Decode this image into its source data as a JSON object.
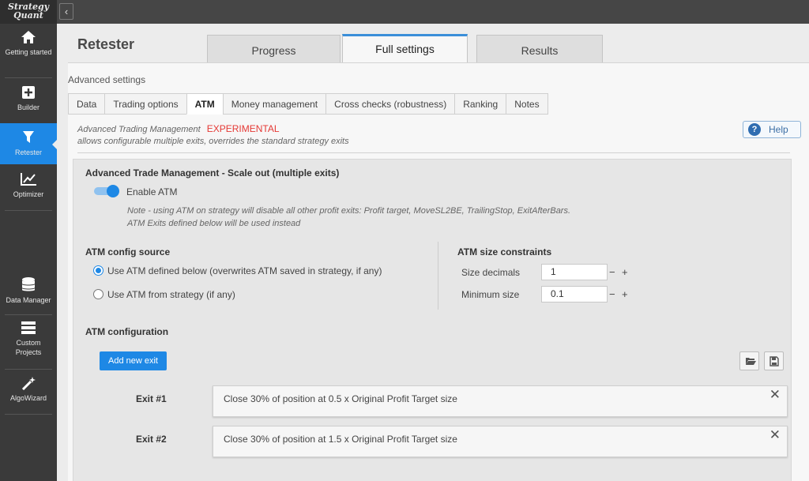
{
  "app": {
    "logo_line1": "Strategy",
    "logo_line2": "Quant"
  },
  "sidebar": {
    "items": [
      {
        "label": "Getting started",
        "icon": "home-icon"
      },
      {
        "label": "Builder",
        "icon": "plus-box-icon"
      },
      {
        "label": "Retester",
        "icon": "filter-icon",
        "active": true
      },
      {
        "label": "Optimizer",
        "icon": "chart-line-icon"
      },
      {
        "label": "Data Manager",
        "icon": "database-icon"
      },
      {
        "label": "Custom Projects",
        "icon": "projects-icon"
      },
      {
        "label": "AlgoWizard",
        "icon": "magic-wand-icon"
      }
    ]
  },
  "header": {
    "title": "Retester",
    "tabs": [
      {
        "label": "Progress"
      },
      {
        "label": "Full settings",
        "active": true
      },
      {
        "label": "Results"
      }
    ]
  },
  "settings": {
    "section_label": "Advanced settings",
    "tabs": [
      "Data",
      "Trading options",
      "ATM",
      "Money management",
      "Cross checks (robustness)",
      "Ranking",
      "Notes"
    ],
    "active_tab": "ATM"
  },
  "atm": {
    "info_title": "Advanced Trading Management",
    "experimental": "EXPERIMENTAL",
    "info_desc": "allows configurable multiple exits, overrides the standard strategy exits",
    "help_label": "Help",
    "box_title": "Advanced Trade Management - Scale out (multiple exits)",
    "enable_label": "Enable ATM",
    "enabled": true,
    "note_line1": "Note - using ATM on strategy will disable all other profit exits: Profit target, MoveSL2BE, TrailingStop, ExitAfterBars.",
    "note_line2": "ATM Exits defined below will be used instead",
    "config_source_title": "ATM config source",
    "source_options": [
      {
        "label": "Use ATM defined below (overwrites ATM saved in strategy, if any)",
        "selected": true
      },
      {
        "label": "Use ATM from strategy (if any)",
        "selected": false
      }
    ],
    "size_constraints_title": "ATM size constraints",
    "size_decimals_label": "Size decimals",
    "size_decimals_value": "1",
    "minimum_size_label": "Minimum size",
    "minimum_size_value": "0.1",
    "config_title": "ATM configuration",
    "add_exit_label": "Add new exit",
    "exits": [
      {
        "label": "Exit #1",
        "text": "Close 30% of position at 0.5 x Original Profit Target size"
      },
      {
        "label": "Exit #2",
        "text": "Close 30% of position at 1.5 x Original Profit Target size"
      }
    ]
  },
  "colors": {
    "accent": "#1e88e5",
    "experimental": "#e53935",
    "sidebar_bg": "#3a3a3a"
  }
}
